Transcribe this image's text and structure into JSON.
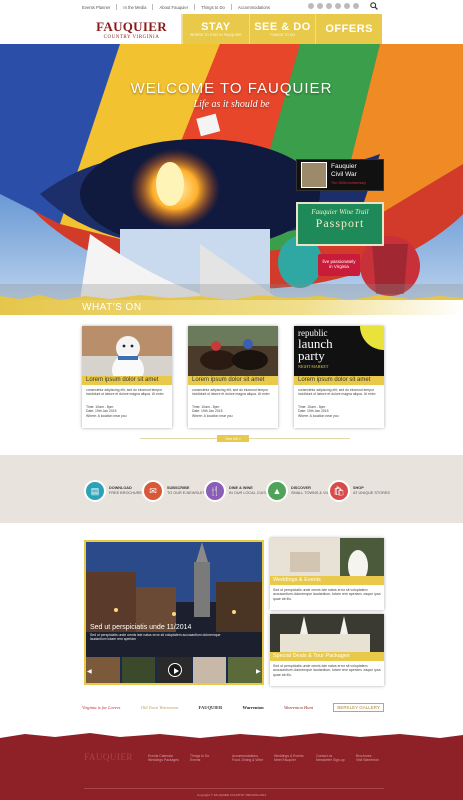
{
  "topnav": {
    "links": [
      "Events Planner",
      "In the Media",
      "About Fauquier",
      "Things to Do",
      "Accommodations"
    ],
    "social_icons": [
      "facebook-icon",
      "twitter-icon",
      "tumblr-icon",
      "youtube-icon",
      "google-plus-icon",
      "rss-icon"
    ]
  },
  "header": {
    "logo_title": "FAUQUIER",
    "logo_sub": "COUNTRY VIRGINIA",
    "tabs": [
      {
        "label": "STAY",
        "sub": "WHERE TO STAY IN FAUQUIER"
      },
      {
        "label": "SEE & DO",
        "sub": "THINGS TO DO"
      },
      {
        "label": "OFFERS",
        "sub": ""
      }
    ]
  },
  "hero": {
    "title": "WELCOME TO FAUQUIER",
    "subtitle": "Life as it should be",
    "promo_civil_war": {
      "line1": "Fauquier",
      "line2": "Civil War",
      "small": "The 150th Anniversary"
    },
    "promo_wine": {
      "line1": "Fauquier Wine Trail",
      "line2": "Passport"
    },
    "promo_virginia": {
      "line1": "live passionately",
      "line2": "in Virginia"
    }
  },
  "whats_on": {
    "title": "WHAT'S ON",
    "cards": [
      {
        "title": "Lorem ipsum dolor sit amet",
        "desc": "consectetur adipiscing elit, sed do eiusmod tempor incididunt ut labore et dolore magna aliqua. Ut enim",
        "time": "Time: 10am - 5pm",
        "date": "Date: 19th Jan 2015",
        "where": "Where: A location near you"
      },
      {
        "title": "Lorem ipsum dolor sit amet",
        "desc": "consectetur adipiscing elit, sed do eiusmod tempor incididunt ut labore et dolore magna aliqua. Ut enim",
        "time": "Time: 10am - 5pm",
        "date": "Date: 19th Jan 2015",
        "where": "Where: A location near you"
      },
      {
        "title": "Lorem ipsum dolor sit amet",
        "desc": "consectetur adipiscing elit, sed do eiusmod tempor incididunt ut labore et dolore magna aliqua. Ut enim",
        "time": "Time: 10am - 5pm",
        "date": "Date: 19th Jan 2015",
        "where": "Where: A location near you"
      }
    ],
    "card3_image_text": {
      "line1": "republic",
      "line2": "launch",
      "line3": "party",
      "line4": "NIGHT MARKET"
    },
    "see_all": "See All »"
  },
  "quicklinks": [
    {
      "title": "DOWNLOAD",
      "sub": "FREE BROCHURES",
      "color": "#2aa3b8",
      "icon": "brochure-icon"
    },
    {
      "title": "SUBSCRIBE",
      "sub": "TO OUR E-NEWSLETTER",
      "color": "#d8583a",
      "icon": "mail-icon"
    },
    {
      "title": "DINE & WINE",
      "sub": "IN OUR LOCAL CUISINE",
      "color": "#8a5db8",
      "icon": "dine-icon"
    },
    {
      "title": "DISCOVER",
      "sub": "SMALL TOWNS & VILLAGES",
      "color": "#4fa35a",
      "icon": "map-icon"
    },
    {
      "title": "SHOP",
      "sub": "AT UNIQUE STORES",
      "color": "#d94b4b",
      "icon": "shop-icon"
    }
  ],
  "feature": {
    "main_title": "Sed ut perspiciatis unde 11/2014",
    "main_desc": "Sed ut perspiciatis unde omnis iste natus error sit voluptatem accusantium doloremque laudantium totam rem aperiam",
    "side": [
      {
        "title": "Weddings & Events",
        "desc": "Sed ut perspiciatis unde omnis iste natus error sit voluptatem accusantium doloremque laudantium, totam rem aperiam, eaque ipsa quae ab illo."
      },
      {
        "title": "Special Deals & Tour Packages",
        "desc": "Sed ut perspiciatis unde omnis iste natus error sit voluptatem accusantium doloremque laudantium, totam rem aperiam, eaque ipsa quae ab illo."
      }
    ]
  },
  "partners": [
    "Virginia is for Lovers",
    "Old Town Warrenton",
    "FAUQUIER",
    "Warrenton",
    "Warrenton Hunt",
    "BERKLEY GALLERY"
  ],
  "footer": {
    "logo": "FAUQUIER",
    "columns": [
      [
        "Events Calendar",
        "Weddings Packages"
      ],
      [
        "Things to Do",
        "Events"
      ],
      [
        "Accommodations",
        "Food, Dining & Wine"
      ],
      [
        "Weddings & Events",
        "Meet Fauquier"
      ],
      [
        "Contact us",
        "Newsletter Sign-up"
      ],
      [
        "Brochures",
        "Visit Warrenton"
      ]
    ],
    "copyright": "Copyright © FAUQUIER COUNTRY VIRGINIA 2014"
  }
}
